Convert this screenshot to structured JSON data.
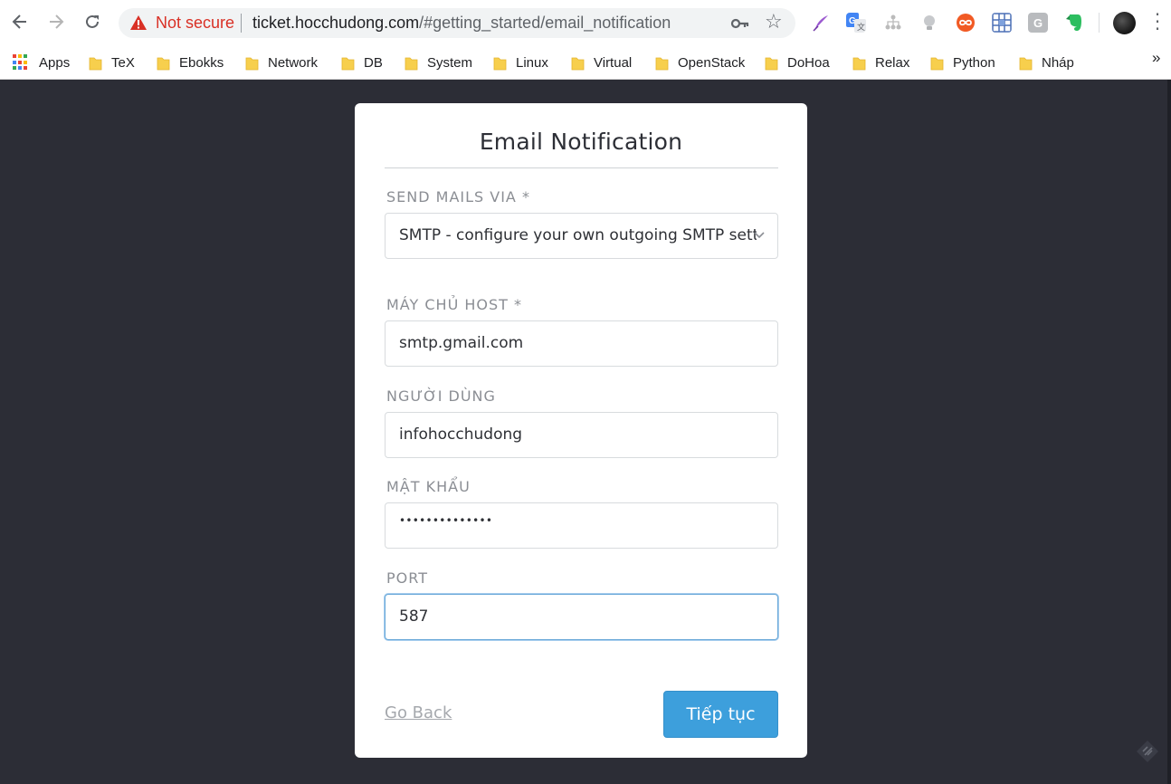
{
  "browser": {
    "not_secure_label": "Not secure",
    "url_host": "ticket.hocchudong.com",
    "url_path": "/#getting_started/email_notification",
    "bookmarks": [
      "TeX",
      "Ebokks",
      "Network",
      "DB",
      "System",
      "Linux",
      "Virtual",
      "OpenStack",
      "DoHoa",
      "Relax",
      "Python",
      "Nháp"
    ],
    "apps_label": "Apps",
    "more_label": "»"
  },
  "form": {
    "title": "Email Notification",
    "send_via_label": "SEND MAILS VIA *",
    "send_via_value": "SMTP - configure your own outgoing SMTP settings",
    "host_label": "MÁY CHỦ HOST *",
    "host_value": "smtp.gmail.com",
    "user_label": "NGƯỜI DÙNG",
    "user_value": "infohocchudong",
    "password_label": "MẬT KHẨU",
    "password_value": "••••••••••••••",
    "port_label": "PORT",
    "port_value": "587",
    "go_back_label": "Go Back",
    "next_label": "Tiếp tục"
  },
  "colors": {
    "page_bg": "#2c2d36",
    "primary_button": "#3d9fdc",
    "insecure_red": "#d93025"
  }
}
